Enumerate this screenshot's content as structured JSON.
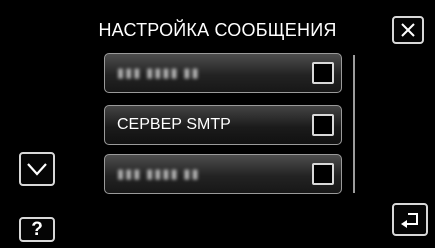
{
  "header": {
    "title": "НАСТРОЙКА СООБЩЕНИЯ"
  },
  "menu": {
    "items": [
      {
        "label": "▮▮▮ ▮▮▮▮ ▮▮",
        "checked": false,
        "obscured": true
      },
      {
        "label": "СЕРВЕР SMTP",
        "checked": false,
        "obscured": false
      },
      {
        "label": "▮▮▮ ▮▮▮▮ ▮▮",
        "checked": false,
        "obscured": true
      }
    ]
  },
  "controls": {
    "help_label": "?"
  },
  "icons": {
    "close": "close-icon",
    "down": "chevron-down-icon",
    "back": "return-arrow-icon"
  },
  "colors": {
    "background": "#000000",
    "border": "#d8d8d8",
    "text": "#ffffff"
  }
}
